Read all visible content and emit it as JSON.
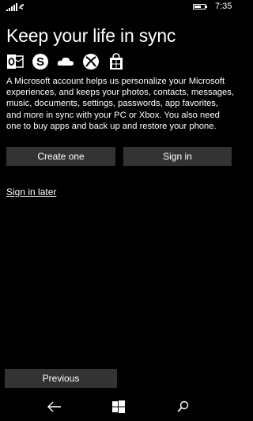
{
  "status_bar": {
    "time": "7:35",
    "battery_level": 0.7
  },
  "page": {
    "title": "Keep your life in sync",
    "description": "A Microsoft account helps us personalize your Microsoft experiences, and keeps your photos, contacts, messages, music, documents, settings, passwords, app favorites, and more in sync with your PC or Xbox. You also need one to buy apps and back up and restore your phone.",
    "app_icons": [
      "outlook-icon",
      "skype-icon",
      "onedrive-icon",
      "xbox-icon",
      "store-icon"
    ]
  },
  "actions": {
    "create_label": "Create one",
    "signin_label": "Sign in",
    "later_label": "Sign in later",
    "previous_label": "Previous"
  },
  "nav_bar": {
    "icons": [
      "back-arrow-icon",
      "windows-start-icon",
      "search-icon"
    ]
  },
  "colors": {
    "background": "#000000",
    "text": "#ffffff",
    "button": "#333333"
  }
}
